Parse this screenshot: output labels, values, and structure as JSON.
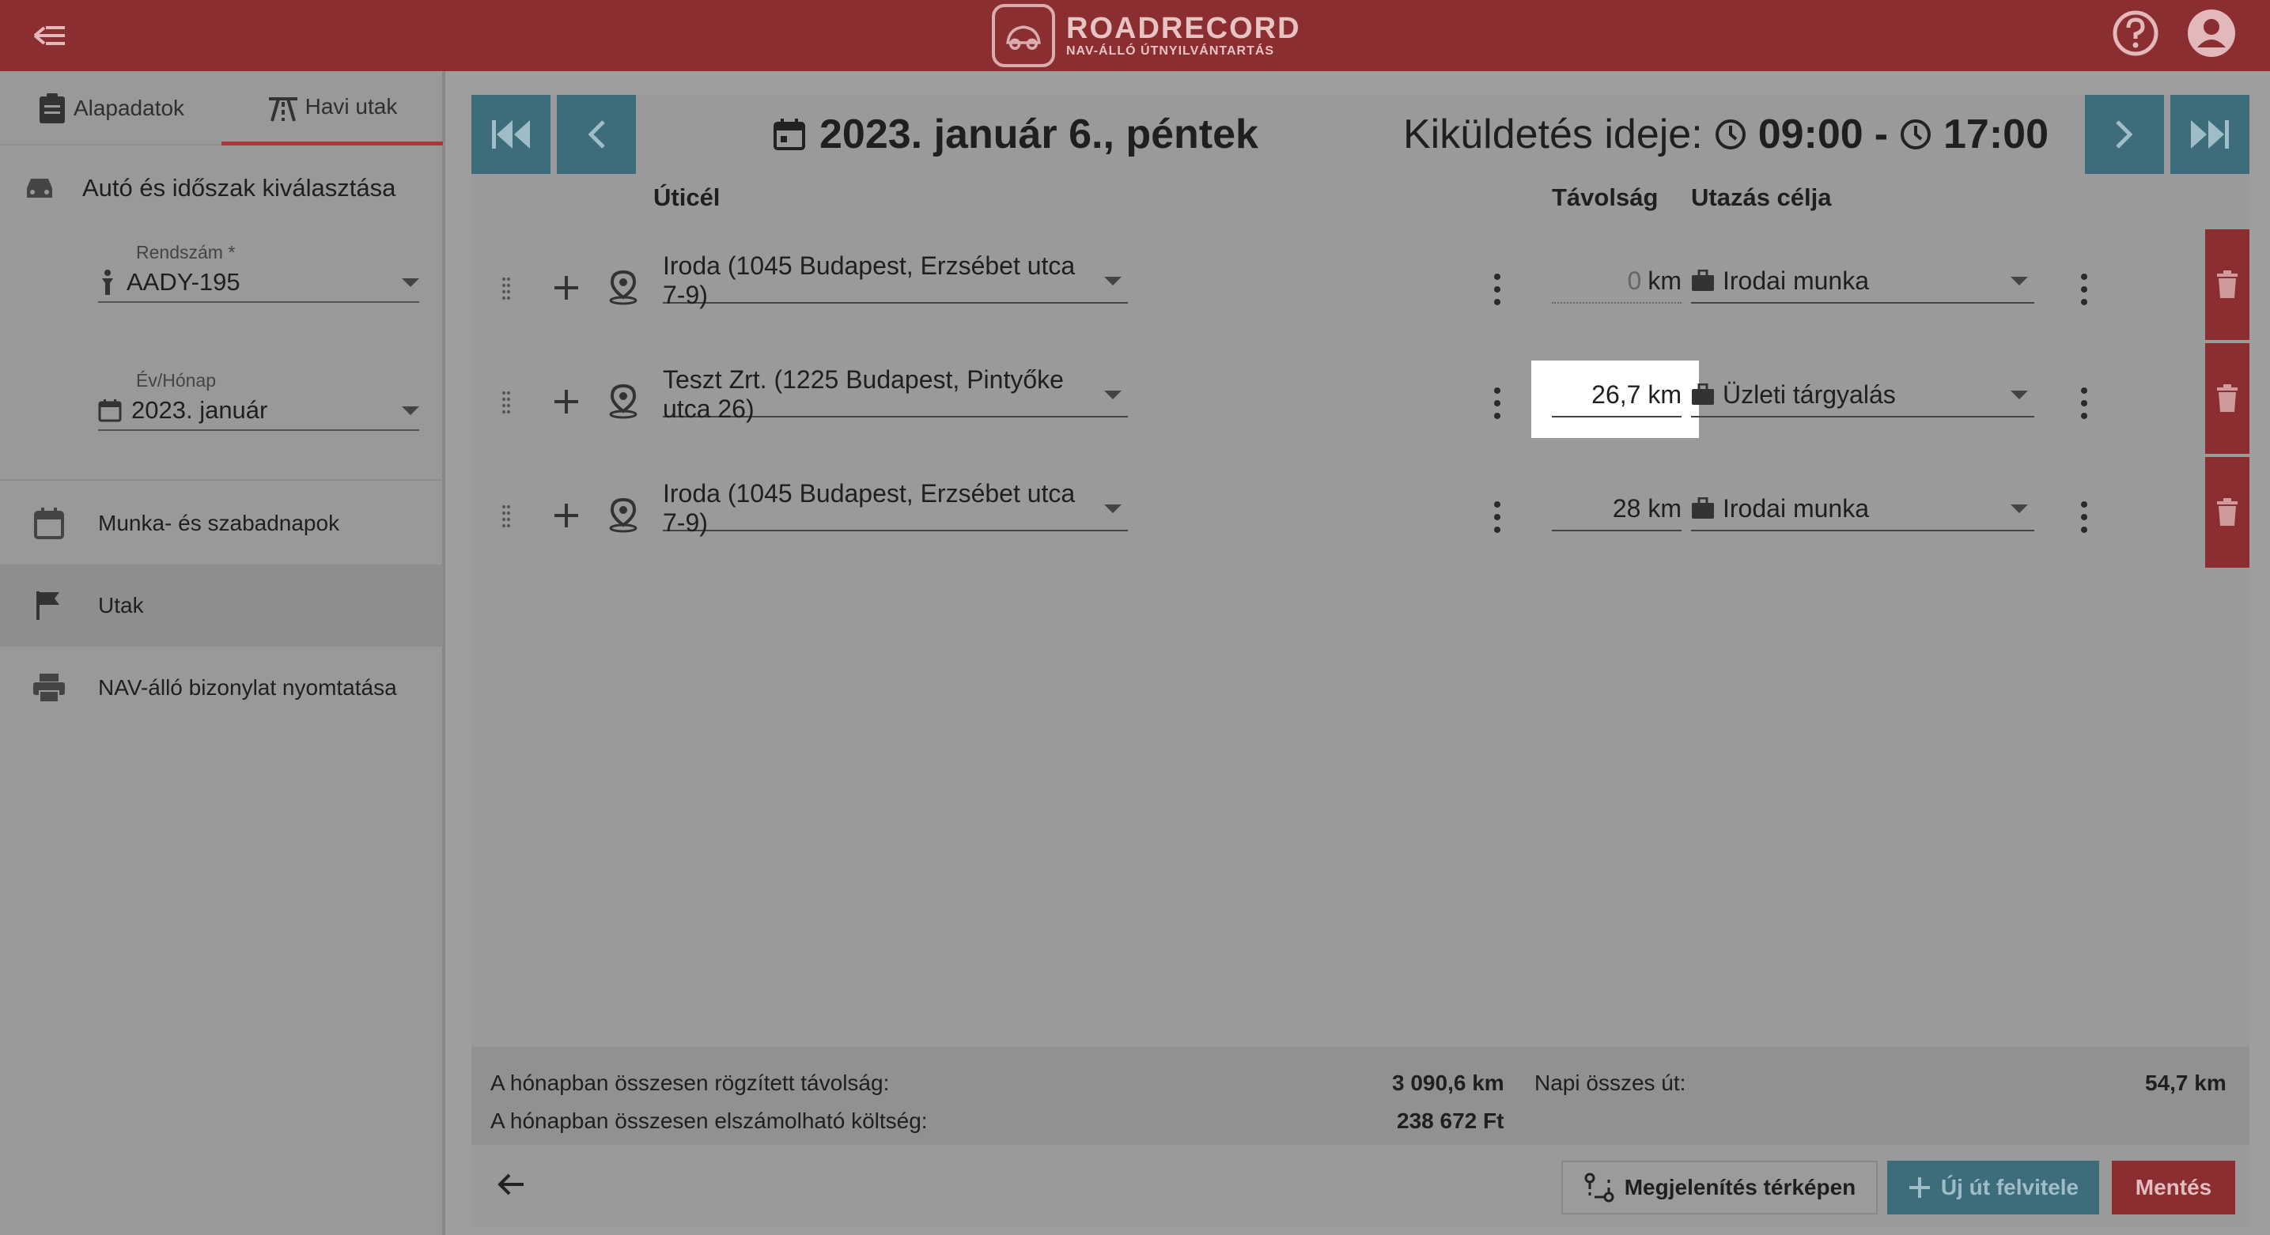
{
  "app": {
    "logo_title": "ROADRECORD",
    "logo_subtitle": "NAV-ÁLLÓ ÚTNYILVÁNTARTÁS",
    "brand_color": "#8b2e31",
    "accent_color": "#3d6c7b"
  },
  "sidebar": {
    "tabs": [
      {
        "label": "Alapadatok",
        "icon": "clipboard-icon"
      },
      {
        "label": "Havi utak",
        "icon": "road-icon"
      }
    ],
    "section_title": "Autó és időszak kiválasztása",
    "plate_field": {
      "label": "Rendszám *",
      "value": "AADY-195"
    },
    "month_field": {
      "label": "Év/Hónap",
      "value": "2023. január"
    },
    "menu": [
      {
        "label": "Munka- és szabadnapok",
        "icon": "calendar-icon"
      },
      {
        "label": "Utak",
        "icon": "flag-icon"
      },
      {
        "label": "NAV-álló bizonylat nyomtatása",
        "icon": "printer-icon"
      }
    ]
  },
  "day": {
    "date_label": "2023. január 6., péntek",
    "time_prefix": "Kiküldetés ideje:",
    "start_time": "09:00",
    "separator": "-",
    "end_time": "17:00"
  },
  "columns": {
    "destination": "Úticél",
    "distance": "Távolság",
    "purpose": "Utazás célja"
  },
  "trips": [
    {
      "destination": "Iroda (1045 Budapest, Erzsébet utca 7-9)",
      "distance": "0",
      "unit": "km",
      "purpose": "Irodai munka"
    },
    {
      "destination": "Teszt Zrt. (1225 Budapest, Pintyőke utca 26)",
      "distance": "26,7 km",
      "unit": "",
      "purpose": "Üzleti tárgyalás"
    },
    {
      "destination": "Iroda (1045 Budapest, Erzsébet utca 7-9)",
      "distance": "28 km",
      "unit": "",
      "purpose": "Irodai munka"
    }
  ],
  "summary": {
    "recorded_label": "A hónapban összesen rögzített távolság:",
    "recorded_value": "3 090,6 km",
    "cost_label": "A hónapban összesen elszámolható költség:",
    "cost_value": "238 672 Ft",
    "daily_label": "Napi összes út:",
    "daily_value": "54,7 km"
  },
  "footer": {
    "map_button": "Megjelenítés térképen",
    "new_trip_button": "Új út felvitele",
    "save_button": "Mentés"
  }
}
